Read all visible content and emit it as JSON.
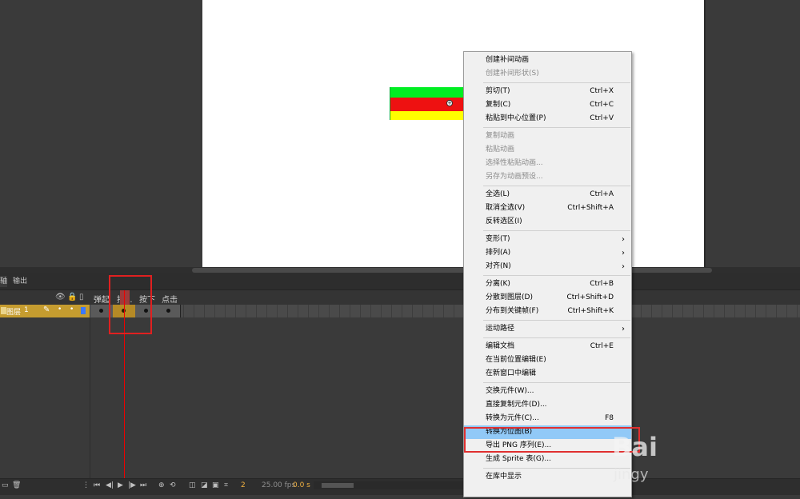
{
  "panel_tabs": [
    "轴",
    "输出"
  ],
  "layer": {
    "name": "图层",
    "number": "1"
  },
  "frame_labels": [
    "弹起",
    "指...",
    "按下",
    "点击"
  ],
  "bottom_bar": {
    "frame": "2",
    "fps": "25.00 fps",
    "time": "0.0 s"
  },
  "context_menu": [
    {
      "label": "创建补间动画",
      "shortcut": "",
      "disabled": false
    },
    {
      "label": "创建补间形状(S)",
      "shortcut": "",
      "disabled": true
    },
    {
      "sep": true
    },
    {
      "label": "剪切(T)",
      "shortcut": "Ctrl+X",
      "disabled": false
    },
    {
      "label": "复制(C)",
      "shortcut": "Ctrl+C",
      "disabled": false
    },
    {
      "label": "粘贴到中心位置(P)",
      "shortcut": "Ctrl+V",
      "disabled": false
    },
    {
      "sep": true
    },
    {
      "label": "复制动画",
      "shortcut": "",
      "disabled": true
    },
    {
      "label": "粘贴动画",
      "shortcut": "",
      "disabled": true
    },
    {
      "label": "选择性粘贴动画...",
      "shortcut": "",
      "disabled": true
    },
    {
      "label": "另存为动画预设...",
      "shortcut": "",
      "disabled": true
    },
    {
      "sep": true
    },
    {
      "label": "全选(L)",
      "shortcut": "Ctrl+A",
      "disabled": false
    },
    {
      "label": "取消全选(V)",
      "shortcut": "Ctrl+Shift+A",
      "disabled": false
    },
    {
      "label": "反转选区(I)",
      "shortcut": "",
      "disabled": false
    },
    {
      "sep": true
    },
    {
      "label": "变形(T)",
      "shortcut": "",
      "arrow": true,
      "disabled": false
    },
    {
      "label": "排列(A)",
      "shortcut": "",
      "arrow": true,
      "disabled": false
    },
    {
      "label": "对齐(N)",
      "shortcut": "",
      "arrow": true,
      "disabled": false
    },
    {
      "sep": true
    },
    {
      "label": "分离(K)",
      "shortcut": "Ctrl+B",
      "disabled": false
    },
    {
      "label": "分散到图层(D)",
      "shortcut": "Ctrl+Shift+D",
      "disabled": false
    },
    {
      "label": "分布到关键帧(F)",
      "shortcut": "Ctrl+Shift+K",
      "disabled": false
    },
    {
      "sep": true
    },
    {
      "label": "运动路径",
      "shortcut": "",
      "arrow": true,
      "disabled": false
    },
    {
      "sep": true
    },
    {
      "label": "编辑文档",
      "shortcut": "Ctrl+E",
      "disabled": false
    },
    {
      "label": "在当前位置编辑(E)",
      "shortcut": "",
      "disabled": false
    },
    {
      "label": "在新窗口中编辑",
      "shortcut": "",
      "disabled": false
    },
    {
      "sep": true
    },
    {
      "label": "交换元件(W)...",
      "shortcut": "",
      "disabled": false
    },
    {
      "label": "直接复制元件(D)...",
      "shortcut": "",
      "disabled": false
    },
    {
      "label": "转换为元件(C)...",
      "shortcut": "F8",
      "disabled": false
    },
    {
      "label": "转换为位图(B)",
      "shortcut": "",
      "disabled": false,
      "highlighted": true
    },
    {
      "label": "导出 PNG 序列(E)...",
      "shortcut": "",
      "disabled": false
    },
    {
      "label": "生成 Sprite 表(G)...",
      "shortcut": "",
      "disabled": false
    },
    {
      "sep": true
    },
    {
      "label": "在库中显示",
      "shortcut": "",
      "disabled": false
    }
  ],
  "watermark": {
    "logo": "Bai",
    "sub": "jingy"
  },
  "colors": {
    "highlight": "#91c9f7",
    "annotation": "#e03030",
    "layer": "#c59c2f"
  }
}
